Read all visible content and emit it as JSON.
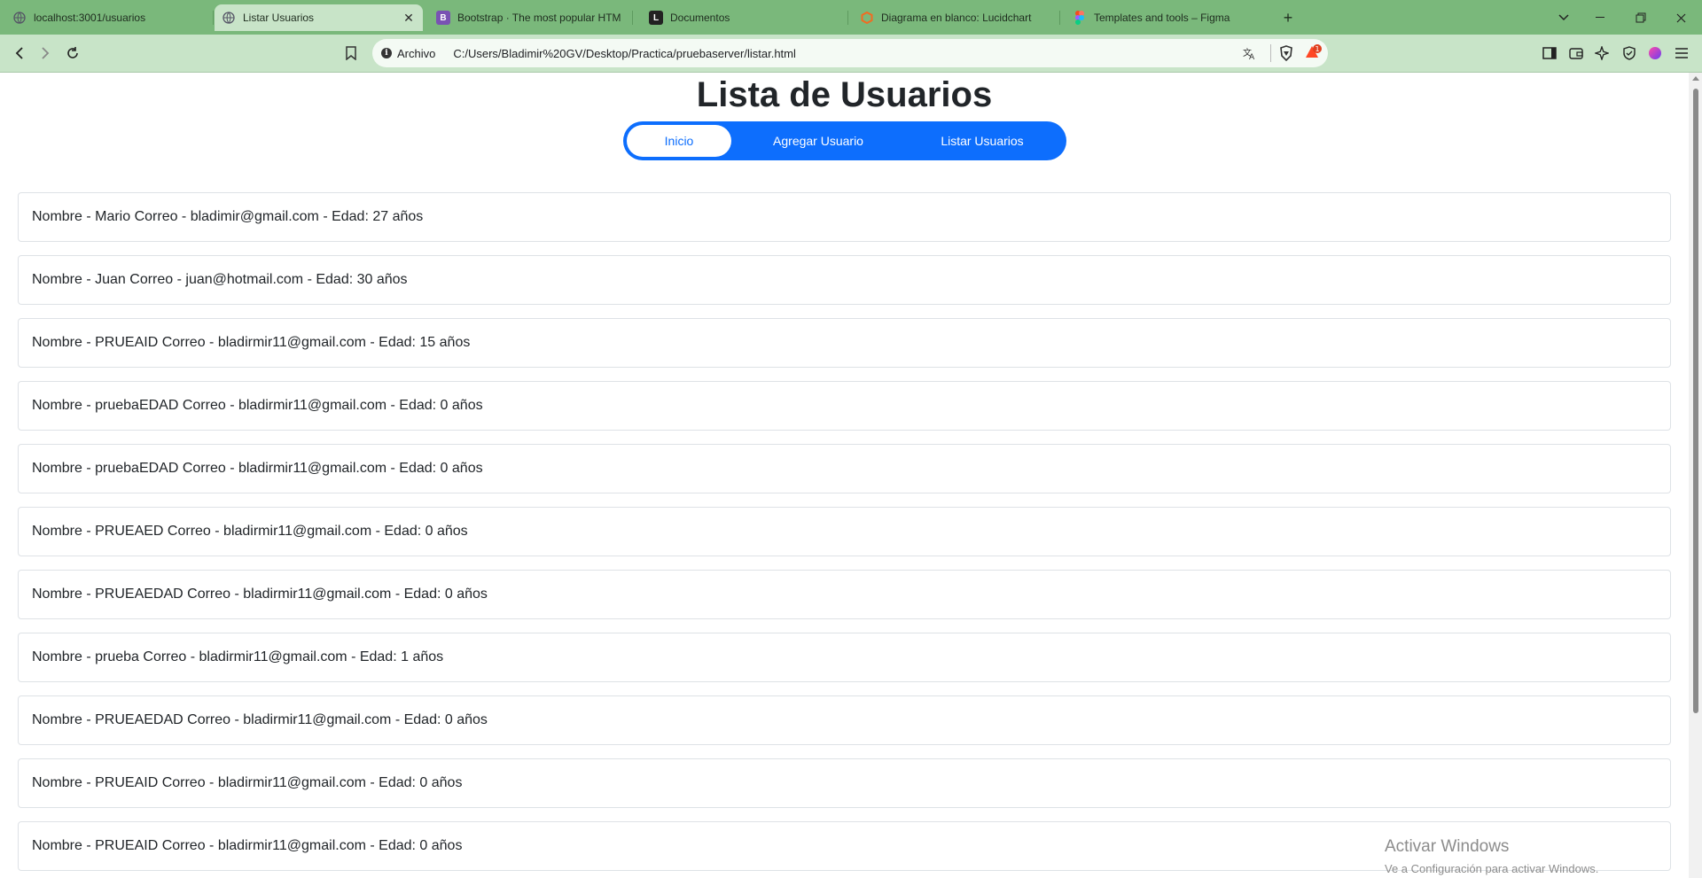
{
  "browser": {
    "tabs": [
      {
        "title": "localhost:3001/usuarios",
        "icon": "globe-icon",
        "active": false
      },
      {
        "title": "Listar Usuarios",
        "icon": "globe-icon",
        "active": true
      },
      {
        "title": "Bootstrap · The most popular HTML",
        "icon": "bootstrap-icon",
        "active": false
      },
      {
        "title": "Documentos",
        "icon": "document-icon",
        "active": false
      },
      {
        "title": "Diagrama en blanco: Lucidchart",
        "icon": "lucidchart-icon",
        "active": false
      },
      {
        "title": "Templates and tools – Figma",
        "icon": "figma-icon",
        "active": false
      }
    ],
    "address": {
      "scheme_label": "Archivo",
      "url": "C:/Users/Bladimir%20GV/Desktop/Practica/pruebaserver/listar.html"
    },
    "colors": {
      "frame": "#7ab87b",
      "toolbar": "#c8e4c8"
    },
    "brave_badge": "1"
  },
  "page": {
    "title": "Lista de Usuarios",
    "nav": {
      "home": "Inicio",
      "add": "Agregar Usuario",
      "list": "Listar Usuarios"
    },
    "users": [
      "Nombre - Mario Correo - bladimir@gmail.com - Edad: 27 años",
      "Nombre - Juan Correo - juan@hotmail.com - Edad: 30 años",
      "Nombre - PRUEAID Correo - bladirmir11@gmail.com - Edad: 15 años",
      "Nombre - pruebaEDAD Correo - bladirmir11@gmail.com - Edad: 0 años",
      "Nombre - pruebaEDAD Correo - bladirmir11@gmail.com - Edad: 0 años",
      "Nombre - PRUEAED Correo - bladirmir11@gmail.com - Edad: 0 años",
      "Nombre - PRUEAEDAD Correo - bladirmir11@gmail.com - Edad: 0 años",
      "Nombre - prueba Correo - bladirmir11@gmail.com - Edad: 1 años",
      "Nombre - PRUEAEDAD Correo - bladirmir11@gmail.com - Edad: 0 años",
      "Nombre - PRUEAID Correo - bladirmir11@gmail.com - Edad: 0 años",
      "Nombre - PRUEAID Correo - bladirmir11@gmail.com - Edad: 0 años"
    ],
    "accent": "#0d6efd"
  },
  "watermark": {
    "line1": "Activar Windows",
    "line2": "Ve a Configuración para activar Windows."
  }
}
